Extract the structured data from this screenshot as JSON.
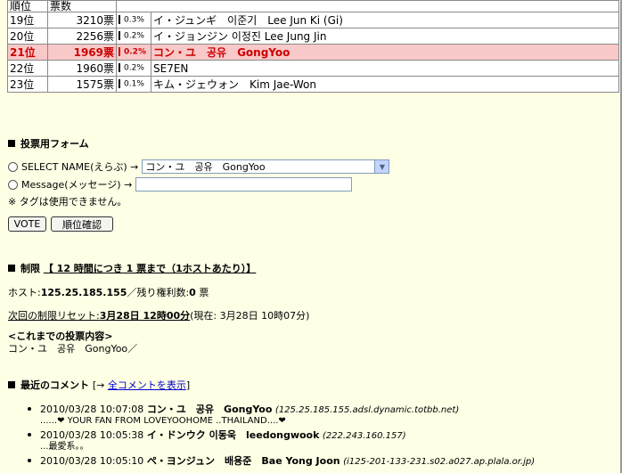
{
  "table": {
    "headers": {
      "rank": "順位",
      "votes": "票数"
    },
    "rows": [
      {
        "rank": "19位",
        "votes": "3210票",
        "pct": "0.3%",
        "name": "イ・ジュンギ　이준기　Lee Jun Ki (Gi)",
        "highlight": false
      },
      {
        "rank": "20位",
        "votes": "2256票",
        "pct": "0.2%",
        "name": "イ・ジョンジン 이정진 Lee Jung Jin",
        "highlight": false
      },
      {
        "rank": "21位",
        "votes": "1969票",
        "pct": "0.2%",
        "name": "コン・ユ　공유　GongYoo",
        "highlight": true
      },
      {
        "rank": "22位",
        "votes": "1960票",
        "pct": "0.2%",
        "name": "SE7EN",
        "highlight": false
      },
      {
        "rank": "23位",
        "votes": "1575票",
        "pct": "0.1%",
        "name": "キム・ジェウォン　Kim Jae-Won",
        "highlight": false
      }
    ]
  },
  "form": {
    "title": "投票用フォーム",
    "select_label": "SELECT NAME(えらぶ) →",
    "select_value": "コン・ユ　공유　GongYoo",
    "message_label": "Message(メッセージ) →",
    "message_value": "",
    "note": "※ タグは使用できません。",
    "vote_button": "VOTE",
    "rank_button": "順位確認"
  },
  "limit": {
    "title_prefix": "制限",
    "title_rule": "【 12 時間につき 1 票まで（1ホストあたり）】",
    "host_label": "ホスト:",
    "host_value": "125.25.185.155",
    "remaining_label": "／残り権利数:",
    "remaining_value": "0",
    "remaining_unit": " 票",
    "reset_label": "次回の制限リセット:",
    "reset_value": "3月28日 12時00分",
    "now_text": "(現在: 3月28日 10時07分)",
    "history_title": "<これまでの投票内容>",
    "history_value": "コン・ユ　공유　GongYoo／"
  },
  "comments": {
    "title": "最近のコメント",
    "link_prefix": "[→ ",
    "link_text": "全コメントを表示",
    "link_suffix": "]",
    "items": [
      {
        "time": "2010/03/28 10:07:08",
        "name": "コン・ユ　공유　GongYoo",
        "ip": "(125.25.185.155.adsl.dynamic.totbb.net)",
        "body": "......❤ YOUR FAN FROM LOVEYOOHOME ..THAILAND....❤"
      },
      {
        "time": "2010/03/28 10:05:38",
        "name": "イ・ドンウク 이동욱　leedongwook",
        "ip": "(222.243.160.157)",
        "body": "...最愛系。。"
      },
      {
        "time": "2010/03/28 10:05:10",
        "name": "ペ・ヨンジュン　배용준　Bae Yong Joon",
        "ip": "(i125-201-133-231.s02.a027.ap.plala.or.jp)",
        "body": ""
      }
    ]
  }
}
